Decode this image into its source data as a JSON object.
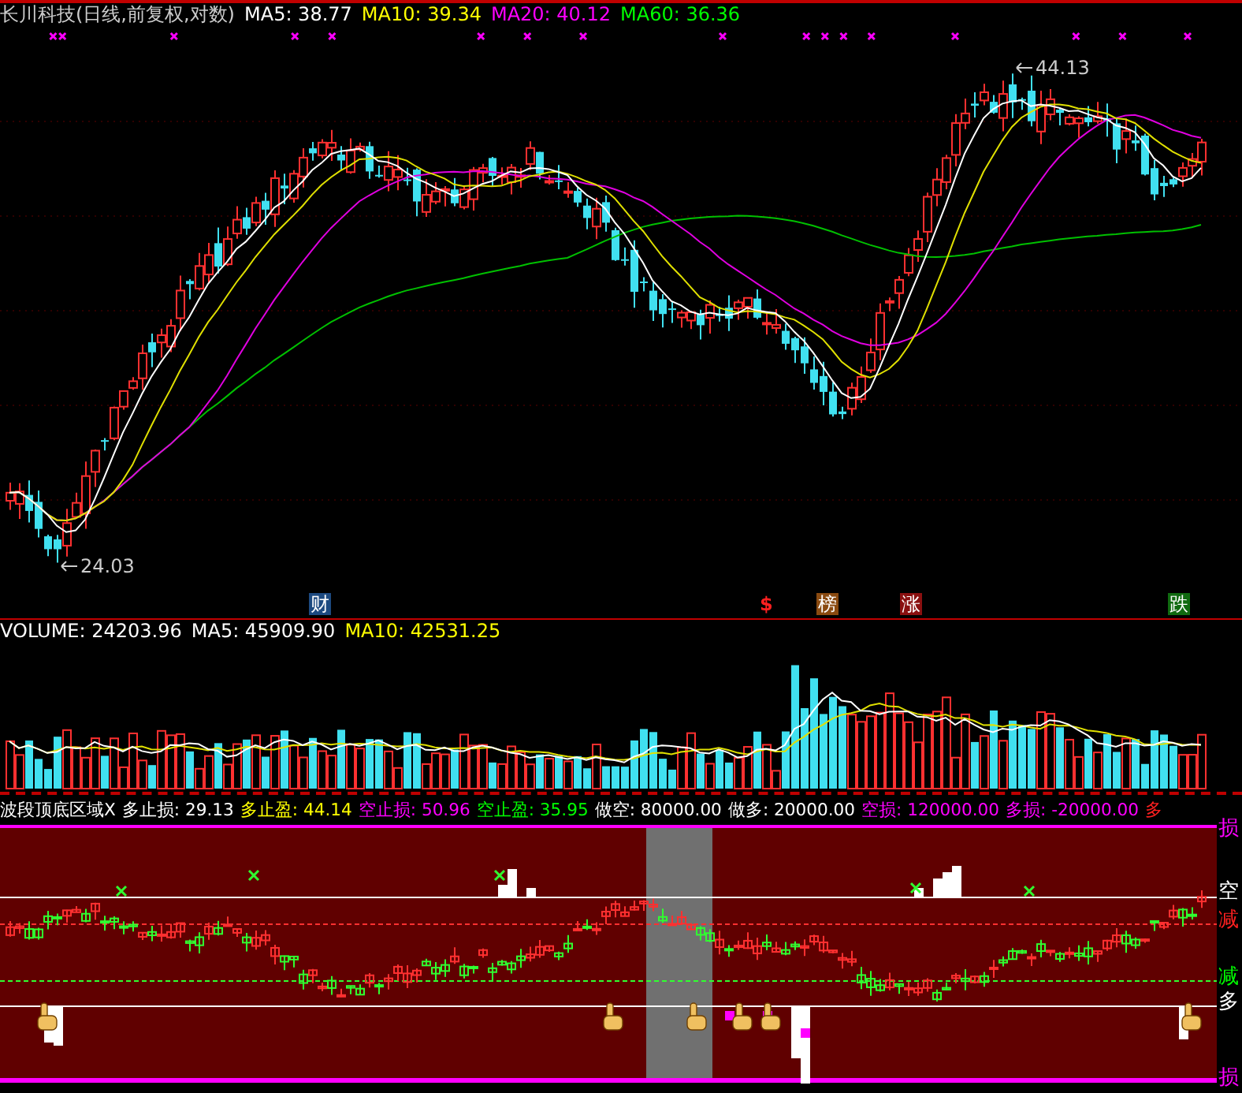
{
  "price_panel": {
    "title": "长川科技(日线,前复权,对数)",
    "legend": [
      {
        "text": "MA5: 38.77",
        "color": "#ffffff"
      },
      {
        "text": "MA10: 39.34",
        "color": "#ffff00"
      },
      {
        "text": "MA20: 40.12",
        "color": "#ff00ff"
      },
      {
        "text": "MA60: 36.36",
        "color": "#00ff00"
      }
    ],
    "high_label": "44.13",
    "low_label": "24.03",
    "events": [
      {
        "label": "财",
        "kind": "badge",
        "color": "#1d4a80"
      },
      {
        "label": "$",
        "kind": "symbol",
        "color": "#ff2020"
      },
      {
        "label": "榜",
        "kind": "badge",
        "color": "#8a4a10"
      },
      {
        "label": "涨",
        "kind": "badge",
        "color": "#8a1010"
      },
      {
        "label": "跌",
        "kind": "badge",
        "color": "#106a10"
      }
    ]
  },
  "volume_panel": {
    "legend": [
      {
        "text": "VOLUME: 24203.96",
        "color": "#ffffff"
      },
      {
        "text": "MA5: 45909.90",
        "color": "#ffffff"
      },
      {
        "text": "MA10: 42531.25",
        "color": "#ffff00"
      }
    ]
  },
  "indicator_panel": {
    "legend": [
      {
        "text": "波段顶底区域X",
        "color": "#ffffff"
      },
      {
        "text": "多止损: 29.13",
        "color": "#ffffff"
      },
      {
        "text": "多止盈: 44.14",
        "color": "#ffff00"
      },
      {
        "text": "空止损: 50.96",
        "color": "#ff00ff"
      },
      {
        "text": "空止盈: 35.95",
        "color": "#00ff00"
      },
      {
        "text": "做空: 80000.00",
        "color": "#ffffff"
      },
      {
        "text": "做多: 20000.00",
        "color": "#ffffff"
      },
      {
        "text": "空损: 120000.00",
        "color": "#ff00ff"
      },
      {
        "text": "多损: -20000.00",
        "color": "#ff00ff"
      },
      {
        "text": "多",
        "color": "#ff2020"
      }
    ],
    "axis_labels": [
      {
        "text": "损",
        "color": "#ff00ff"
      },
      {
        "text": "空",
        "color": "#ffffff"
      },
      {
        "text": "减",
        "color": "#ff2020"
      },
      {
        "text": "减",
        "color": "#00ff00"
      },
      {
        "text": "多",
        "color": "#ffffff"
      },
      {
        "text": "损",
        "color": "#ff00ff"
      }
    ]
  }
}
